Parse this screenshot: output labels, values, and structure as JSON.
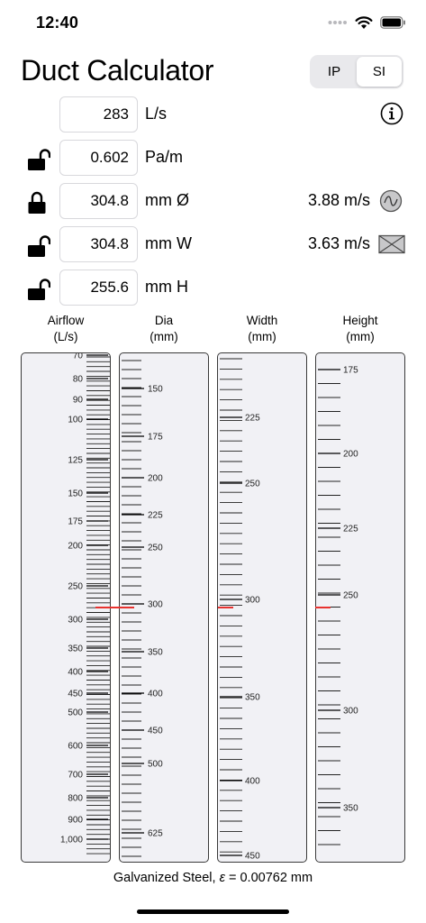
{
  "status": {
    "time": "12:40"
  },
  "title": "Duct Calculator",
  "units_toggle": {
    "options": [
      "IP",
      "SI"
    ],
    "selected": "SI"
  },
  "inputs": [
    {
      "value": "283",
      "unit": "L/s",
      "lock": "none"
    },
    {
      "value": "0.602",
      "unit": "Pa/m",
      "lock": "unlocked"
    },
    {
      "value": "304.8",
      "unit": "mm Ø",
      "lock": "locked",
      "velocity": "3.88 m/s",
      "shape_icon": "round-duct-icon"
    },
    {
      "value": "304.8",
      "unit": "mm W",
      "lock": "unlocked",
      "velocity": "3.63 m/s",
      "shape_icon": "rectangular-duct-icon"
    },
    {
      "value": "255.6",
      "unit": "mm H",
      "lock": "unlocked"
    }
  ],
  "scales": [
    {
      "line1": "Airflow",
      "line2": "(L/s)",
      "labels": [
        "70",
        "80",
        "90",
        "100",
        "125",
        "150",
        "175",
        "200",
        "250",
        "300",
        "350",
        "400",
        "450",
        "500",
        "600",
        "700",
        "800",
        "900",
        "1,000"
      ],
      "marker_value": "283"
    },
    {
      "line1": "Dia",
      "line2": "(mm)",
      "labels": [
        "150",
        "175",
        "200",
        "225",
        "250",
        "300",
        "350",
        "400",
        "450",
        "500",
        "625"
      ],
      "marker_value": "304.8"
    },
    {
      "line1": "Width",
      "line2": "(mm)",
      "labels": [
        "225",
        "250",
        "300",
        "350",
        "400",
        "450"
      ],
      "marker_value": "304.8"
    },
    {
      "line1": "Height",
      "line2": "(mm)",
      "labels": [
        "175",
        "200",
        "225",
        "250",
        "300",
        "350"
      ],
      "marker_value": "255.6"
    }
  ],
  "footer": {
    "prefix": "Galvanized Steel, ",
    "epsilon": "ε",
    "suffix": " = 0.00762 mm"
  },
  "colors": {
    "marker": "#e8322f",
    "scale_bg": "#f1f1f5",
    "toggle_bg": "#e9e9ec"
  }
}
